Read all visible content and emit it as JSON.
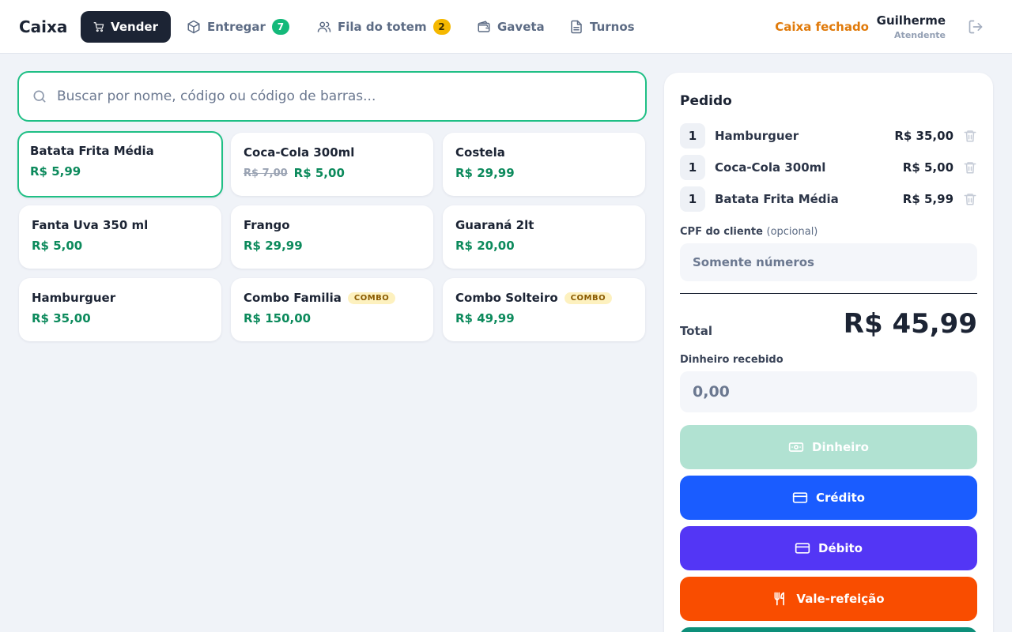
{
  "header": {
    "brand": "Caixa",
    "tabs": [
      {
        "label": "Vender",
        "icon": "cart-icon",
        "active": true
      },
      {
        "label": "Entregar",
        "icon": "package-icon",
        "badge": "7"
      },
      {
        "label": "Fila do totem",
        "icon": "users-icon",
        "badge": "2"
      },
      {
        "label": "Gaveta",
        "icon": "wallet-icon"
      },
      {
        "label": "Turnos",
        "icon": "document-icon"
      }
    ],
    "status": "Caixa fechado",
    "user": {
      "name": "Guilherme",
      "role": "Atendente"
    },
    "logout_icon": "logout-icon"
  },
  "search": {
    "placeholder": "Buscar por nome, código ou código de barras..."
  },
  "products": [
    {
      "name": "Batata Frita Média",
      "price": "R$ 5,99"
    },
    {
      "name": "Coca-Cola 300ml",
      "old_price": "R$ 7,00",
      "price": "R$ 5,00"
    },
    {
      "name": "Costela",
      "price": "R$ 29,99"
    },
    {
      "name": "Fanta Uva 350 ml",
      "price": "R$ 5,00"
    },
    {
      "name": "Frango",
      "price": "R$ 29,99"
    },
    {
      "name": "Guaraná 2lt",
      "price": "R$ 20,00"
    },
    {
      "name": "Hamburguer",
      "price": "R$ 35,00"
    },
    {
      "name": "Combo Familia",
      "badge": "COMBO",
      "price": "R$ 150,00"
    },
    {
      "name": "Combo Solteiro",
      "badge": "COMBO",
      "price": "R$ 49,99"
    }
  ],
  "order": {
    "title": "Pedido",
    "items": [
      {
        "qty": "1",
        "name": "Hamburguer",
        "price": "R$ 35,00"
      },
      {
        "qty": "1",
        "name": "Coca-Cola 300ml",
        "price": "R$ 5,00"
      },
      {
        "qty": "1",
        "name": "Batata Frita Média",
        "price": "R$ 5,99"
      }
    ],
    "cpf_label": "CPF do cliente",
    "cpf_optional": "(opcional)",
    "cpf_placeholder": "Somente números",
    "total_label": "Total",
    "total_value": "R$ 45,99",
    "cash_label": "Dinheiro recebido",
    "cash_placeholder": "0,00",
    "payments": [
      {
        "label": "Dinheiro",
        "icon": "cash-icon",
        "color": "#b1e2d2"
      },
      {
        "label": "Crédito",
        "icon": "credit-card-icon",
        "color": "#1a5cff"
      },
      {
        "label": "Débito",
        "icon": "debit-card-icon",
        "color": "#5336f5"
      },
      {
        "label": "Vale-refeição",
        "icon": "cutlery-icon",
        "color": "#f94d00"
      }
    ]
  },
  "colors": {
    "accent_green": "#1fbf85",
    "price_green": "#0c8a5c",
    "status_orange": "#e07a0a",
    "dark": "#1c2434"
  }
}
